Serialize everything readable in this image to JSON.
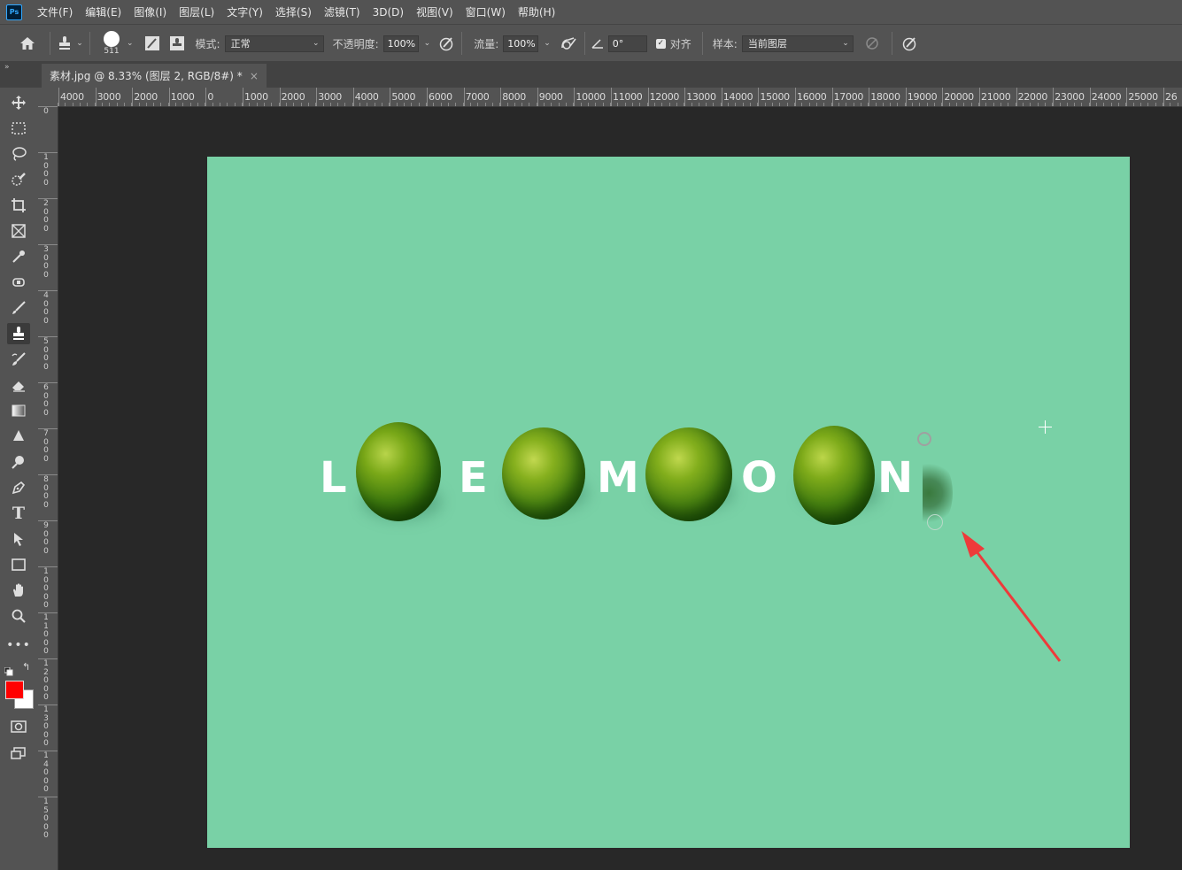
{
  "app": {
    "logo": "Ps"
  },
  "menu": [
    "文件(F)",
    "编辑(E)",
    "图像(I)",
    "图层(L)",
    "文字(Y)",
    "选择(S)",
    "滤镜(T)",
    "3D(D)",
    "视图(V)",
    "窗口(W)",
    "帮助(H)"
  ],
  "options": {
    "brush_size": "511",
    "mode_label": "模式:",
    "mode_value": "正常",
    "opacity_label": "不透明度:",
    "opacity_value": "100%",
    "flow_label": "流量:",
    "flow_value": "100%",
    "angle_value": "0°",
    "aligned_label": "对齐",
    "aligned_checked": true,
    "sample_label": "样本:",
    "sample_value": "当前图层"
  },
  "tab": {
    "title": "素材.jpg @ 8.33% (图层 2, RGB/8#) *",
    "close": "×"
  },
  "ruler_h": [
    "4000",
    "3000",
    "2000",
    "1000",
    "0",
    "1000",
    "2000",
    "3000",
    "4000",
    "5000",
    "6000",
    "7000",
    "8000",
    "9000",
    "10000",
    "11000",
    "12000",
    "13000",
    "14000",
    "15000",
    "16000",
    "17000",
    "18000",
    "19000",
    "20000",
    "21000",
    "22000",
    "23000",
    "24000",
    "25000",
    "26"
  ],
  "ruler_v": [
    "0",
    "1000",
    "2000",
    "3000",
    "4000",
    "5000",
    "6000",
    "7000",
    "8000",
    "9000",
    "10000",
    "11000",
    "12000",
    "13000",
    "14000",
    "15000"
  ],
  "artwork": {
    "letters": [
      "L",
      "E",
      "M",
      "O",
      "N"
    ],
    "background_color": "#79d1a6",
    "accent_arrow_color": "#ee3a3a",
    "foreground_color": "#ff0000",
    "background_swatch": "#ffffff"
  },
  "tools": [
    "move-tool-icon",
    "marquee-tool-icon",
    "lasso-tool-icon",
    "quick-select-tool-icon",
    "crop-tool-icon",
    "frame-tool-icon",
    "eyedropper-tool-icon",
    "healing-brush-tool-icon",
    "brush-tool-icon",
    "clone-stamp-tool-icon",
    "history-brush-tool-icon",
    "eraser-tool-icon",
    "gradient-tool-icon",
    "blur-tool-icon",
    "dodge-tool-icon",
    "pen-tool-icon",
    "type-tool-icon",
    "path-select-tool-icon",
    "rectangle-tool-icon",
    "hand-tool-icon",
    "zoom-tool-icon",
    "more-tools-icon"
  ]
}
